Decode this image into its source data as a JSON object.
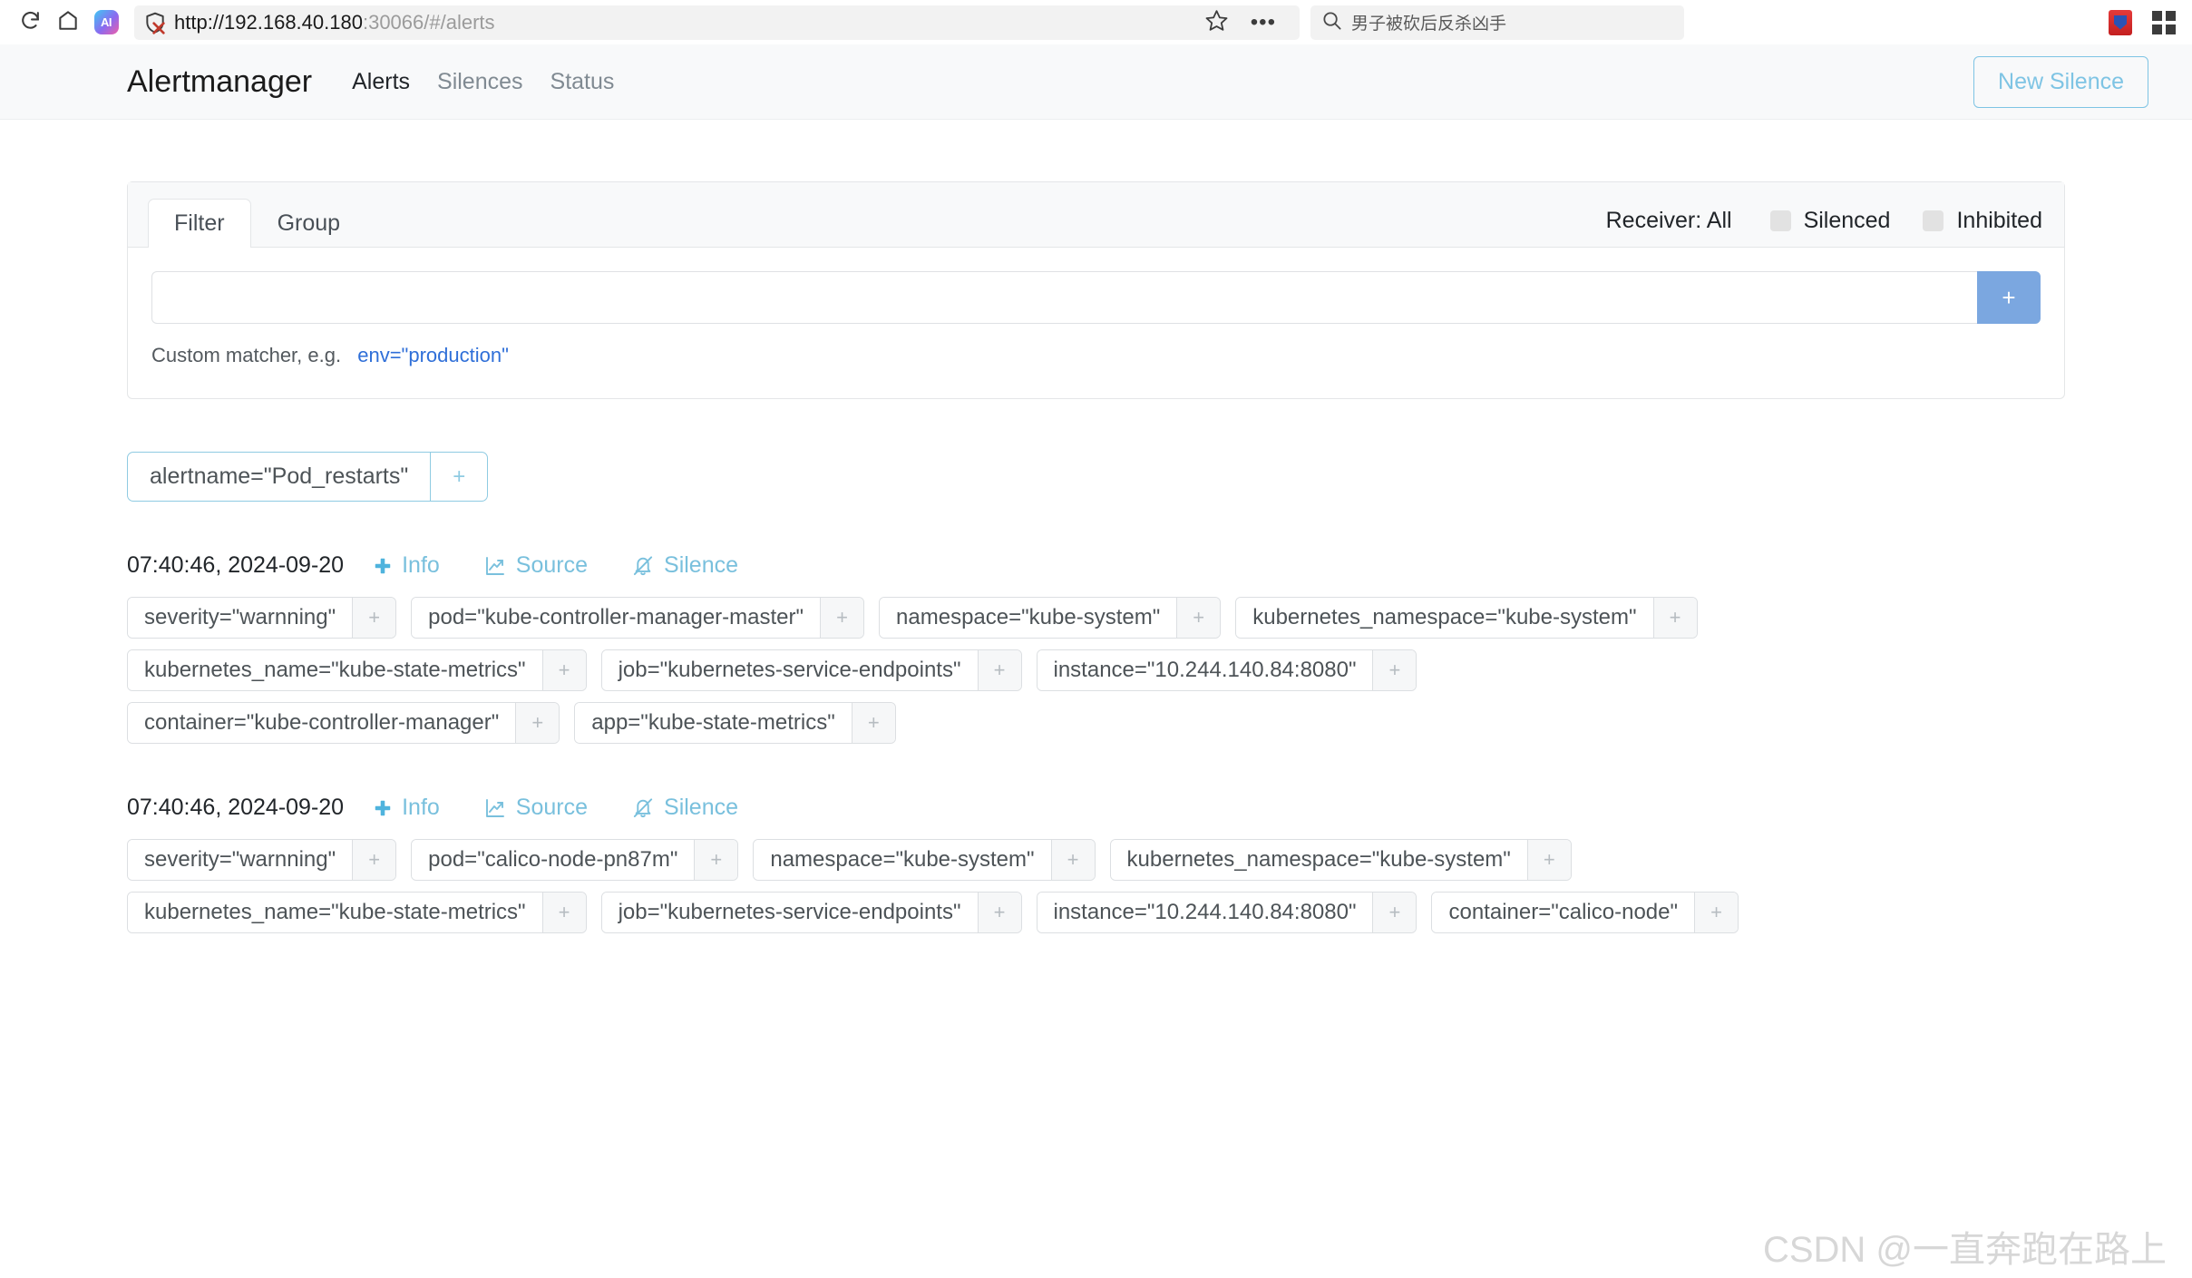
{
  "browser": {
    "reload_icon": "reload-icon",
    "home_icon": "home-icon",
    "ai_badge": "AI",
    "shield_icon": "shield-blocked-icon",
    "url_scheme": "http://192.168.40.180",
    "url_port_path": ":30066/#/alerts",
    "url_full": "http://192.168.40.180:30066/#/alerts",
    "star_icon": "star-icon",
    "more_icon": "more-options-icon",
    "search_icon": "search-icon",
    "search_query": "男子被砍后反杀凶手",
    "extension_icon": "extension-icon",
    "apps_grid_icon": "apps-grid-icon"
  },
  "navbar": {
    "brand": "Alertmanager",
    "links": [
      {
        "label": "Alerts",
        "active": true
      },
      {
        "label": "Silences",
        "active": false
      },
      {
        "label": "Status",
        "active": false
      }
    ],
    "new_silence_label": "New Silence",
    "accent": "#7ec4e4"
  },
  "filter_panel": {
    "tabs": [
      {
        "label": "Filter",
        "active": true
      },
      {
        "label": "Group",
        "active": false
      }
    ],
    "receiver_label": "Receiver: All",
    "checkboxes": [
      {
        "label": "Silenced",
        "checked": false
      },
      {
        "label": "Inhibited",
        "checked": false
      }
    ],
    "matcher_value": "",
    "matcher_placeholder": "",
    "add_button_label": "+",
    "hint_prefix": "Custom matcher, e.g.",
    "hint_code": "env=\"production\""
  },
  "active_filter": {
    "label": "alertname=\"Pod_restarts\"",
    "plus": "+"
  },
  "alerts": [
    {
      "time": "07:40:46, 2024-09-20",
      "actions": [
        {
          "label": "Info",
          "icon": "plus-icon"
        },
        {
          "label": "Source",
          "icon": "chart-line-icon"
        },
        {
          "label": "Silence",
          "icon": "bell-slash-icon"
        }
      ],
      "label_rows": [
        [
          "severity=\"warnning\"",
          "pod=\"kube-controller-manager-master\"",
          "namespace=\"kube-system\"",
          "kubernetes_namespace=\"kube-system\""
        ],
        [
          "kubernetes_name=\"kube-state-metrics\"",
          "job=\"kubernetes-service-endpoints\"",
          "instance=\"10.244.140.84:8080\""
        ],
        [
          "container=\"kube-controller-manager\"",
          "app=\"kube-state-metrics\""
        ]
      ]
    },
    {
      "time": "07:40:46, 2024-09-20",
      "actions": [
        {
          "label": "Info",
          "icon": "plus-icon"
        },
        {
          "label": "Source",
          "icon": "chart-line-icon"
        },
        {
          "label": "Silence",
          "icon": "bell-slash-icon"
        }
      ],
      "label_rows": [
        [
          "severity=\"warnning\"",
          "pod=\"calico-node-pn87m\"",
          "namespace=\"kube-system\"",
          "kubernetes_namespace=\"kube-system\""
        ],
        [
          "kubernetes_name=\"kube-state-metrics\"",
          "job=\"kubernetes-service-endpoints\"",
          "instance=\"10.244.140.84:8080\"",
          "container=\"calico-node\""
        ]
      ]
    }
  ],
  "watermark": "CSDN @一直奔跑在路上"
}
